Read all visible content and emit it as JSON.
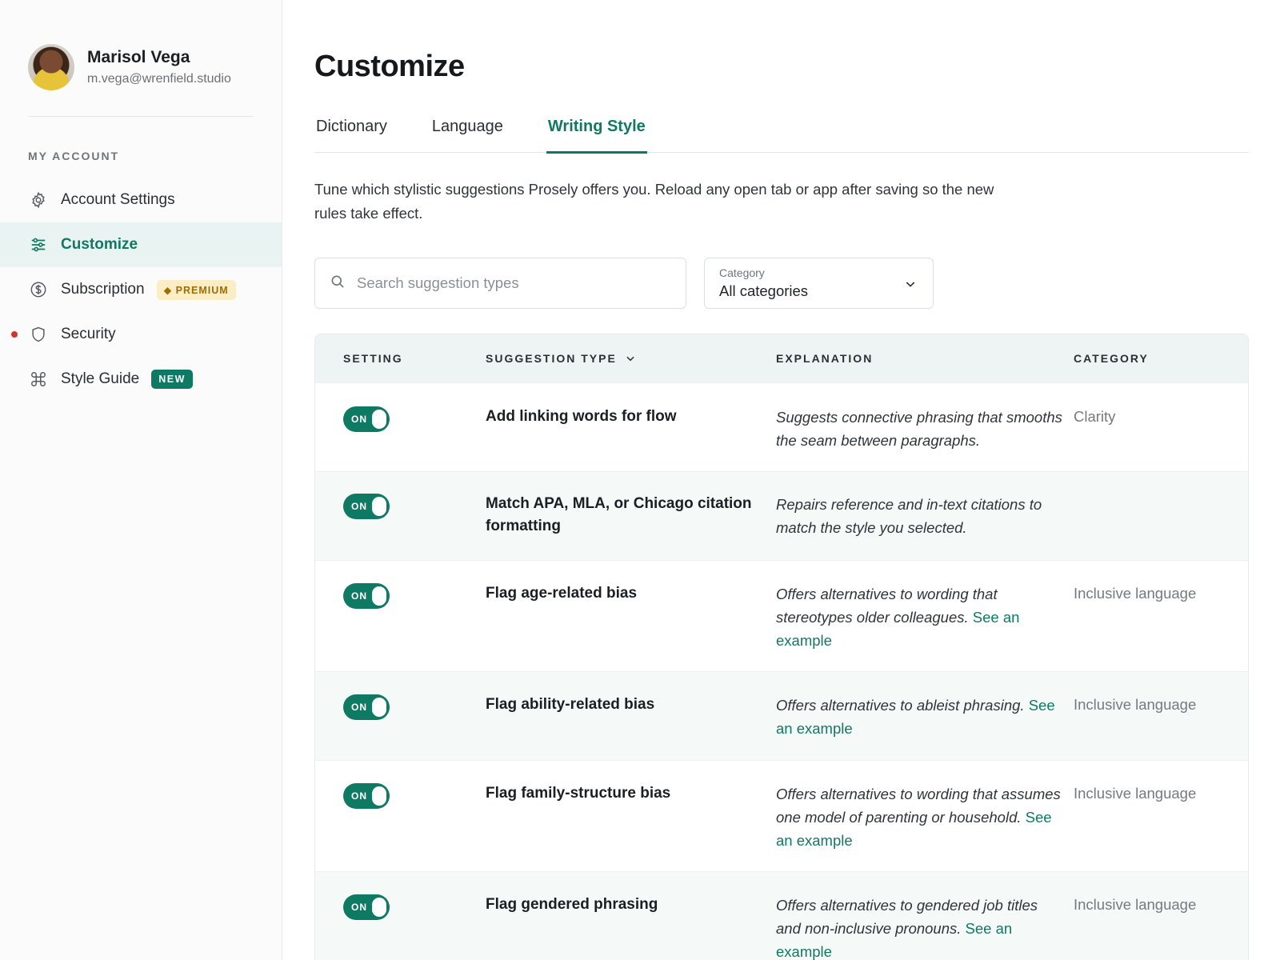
{
  "profile": {
    "name": "Marisol Vega",
    "email": "m.vega@wrenfield.studio"
  },
  "sidebar": {
    "section_label": "MY ACCOUNT",
    "items": [
      {
        "label": "Account Settings",
        "icon": "gear-icon",
        "active": false
      },
      {
        "label": "Customize",
        "icon": "sliders-icon",
        "active": true
      },
      {
        "label": "Subscription",
        "icon": "dollar-icon",
        "active": false,
        "badge": "◆ PREMIUM"
      },
      {
        "label": "Security",
        "icon": "shield-icon",
        "active": false,
        "alert": true
      },
      {
        "label": "Style Guide",
        "icon": "command-icon",
        "active": false,
        "badge": "NEW"
      }
    ]
  },
  "page": {
    "title": "Customize"
  },
  "tabs": [
    {
      "label": "Dictionary",
      "active": false
    },
    {
      "label": "Language",
      "active": false
    },
    {
      "label": "Writing Style",
      "active": true
    }
  ],
  "intro": "Tune which stylistic suggestions Prosely offers you. Reload any open tab or app after saving so the new rules take effect.",
  "search": {
    "placeholder": "Search suggestion types",
    "value": ""
  },
  "category_select": {
    "label": "Category",
    "value": "All categories"
  },
  "table": {
    "headers": {
      "setting": "SETTING",
      "type": "SUGGESTION TYPE",
      "explanation": "EXPLANATION",
      "category": "CATEGORY"
    },
    "rows": [
      {
        "toggle": "ON",
        "type": "Add linking words for flow",
        "explanation": "Suggests connective phrasing that smooths the seam between paragraphs.",
        "link": "",
        "category": "Clarity"
      },
      {
        "toggle": "ON",
        "type": "Match APA, MLA, or Chicago citation formatting",
        "explanation": "Repairs reference and in-text citations to match the style you selected.",
        "link": "",
        "category": ""
      },
      {
        "toggle": "ON",
        "type": "Flag age-related bias",
        "explanation": "Offers alternatives to wording that stereotypes older colleagues.",
        "link": "See an example",
        "category": "Inclusive language"
      },
      {
        "toggle": "ON",
        "type": "Flag ability-related bias",
        "explanation": "Offers alternatives to ableist phrasing.",
        "link": "See an example",
        "category": "Inclusive language"
      },
      {
        "toggle": "ON",
        "type": "Flag family-structure bias",
        "explanation": "Offers alternatives to wording that assumes one model of parenting or household.",
        "link": "See an example",
        "category": "Inclusive language"
      },
      {
        "toggle": "ON",
        "type": "Flag gendered phrasing",
        "explanation": "Offers alternatives to gendered job titles and non-inclusive pronouns.",
        "link": "See an example",
        "category": "Inclusive language"
      }
    ]
  },
  "colors": {
    "accent": "#0f7a64",
    "premium_bg": "#fbeec6",
    "premium_text": "#a06d05",
    "alert": "#d0342c"
  }
}
